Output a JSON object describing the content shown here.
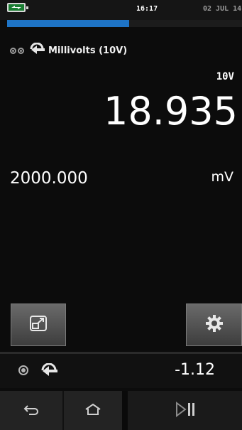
{
  "status_bar": {
    "time": "16:17",
    "date": "02 JUL 14",
    "battery_icon": "battery-charging-icon",
    "progress_fraction": 0.52
  },
  "channel": {
    "title": "Millivolts (10V)",
    "range": "10V",
    "reading": "18.935",
    "setpoint": "2000.000",
    "unit": "mV"
  },
  "buttons": {
    "expand_icon": "expand-icon",
    "settings_icon": "gear-icon"
  },
  "secondary": {
    "reading": "-1.12"
  },
  "nav": {
    "back_icon": "back-icon",
    "home_icon": "home-icon",
    "run_icon": "play-pause-icon"
  },
  "colors": {
    "progress": "#1e74c6",
    "background": "#0c0c0c"
  }
}
